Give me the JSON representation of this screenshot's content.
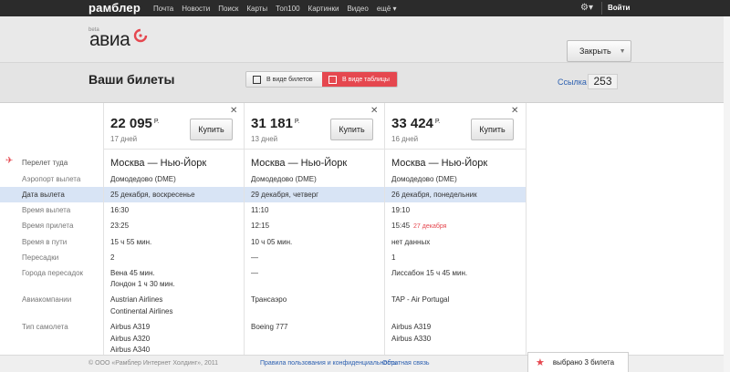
{
  "topbar": {
    "logo": "рамблер",
    "nav": [
      "Почта",
      "Новости",
      "Поиск",
      "Карты",
      "Топ100",
      "Картинки",
      "Видео",
      "ещё ▾"
    ],
    "gear_icon": "gear-icon",
    "login": "Войти"
  },
  "brand": {
    "beta": "beta",
    "name": "авиа"
  },
  "header": {
    "close_label": "Закрыть"
  },
  "subbar": {
    "title": "Ваши билеты",
    "view_cards": "В виде билетов",
    "view_table": "В виде таблицы",
    "link": "Ссылка",
    "count": "253"
  },
  "row_labels": [
    "Перелет туда",
    "Аэропорт вылета",
    "Дата вылета",
    "Время вылета",
    "Время прилета",
    "Время в пути",
    "Пересадки",
    "Города пересадок",
    "Авиакомпании",
    "Тип самолета"
  ],
  "tickets": [
    {
      "price": "22 095",
      "currency": "Р.",
      "days": "17 дней",
      "buy": "Купить",
      "route": "Москва — Нью-Йорк",
      "airport": "Домодедово (DME)",
      "date": "25 декабря, воскресенье",
      "dep": "16:30",
      "arr": "23:25",
      "arr_note": "",
      "duration": "15 ч 55 мин.",
      "stops": "2",
      "stop_cities": [
        "Вена 45 мин.",
        "Лондон 1 ч 30 мин."
      ],
      "airlines": [
        "Austrian Airlines",
        "Continental Airlines"
      ],
      "aircraft": [
        "Airbus A319",
        "Airbus A320",
        "Airbus A340"
      ]
    },
    {
      "price": "31 181",
      "currency": "Р.",
      "days": "13 дней",
      "buy": "Купить",
      "route": "Москва — Нью-Йорк",
      "airport": "Домодедово (DME)",
      "date": "29 декабря, четверг",
      "dep": "11:10",
      "arr": "12:15",
      "arr_note": "",
      "duration": "10 ч 05 мин.",
      "stops": "—",
      "stop_cities": [
        "—"
      ],
      "airlines": [
        "Трансаэро"
      ],
      "aircraft": [
        "Boeing 777"
      ]
    },
    {
      "price": "33 424",
      "currency": "Р.",
      "days": "16 дней",
      "buy": "Купить",
      "route": "Москва — Нью-Йорк",
      "airport": "Домодедово (DME)",
      "date": "26 декабря, понедельник",
      "dep": "19:10",
      "arr": "15:45",
      "arr_note": "27 декабря",
      "duration": "нет данных",
      "stops": "1",
      "stop_cities": [
        "Лиссабон 15 ч 45 мин."
      ],
      "airlines": [
        "TAP - Air Portugal"
      ],
      "aircraft": [
        "Airbus A319",
        "Airbus A330"
      ]
    }
  ],
  "footer": {
    "copyright": "© ООО «Рамблер Интернет Холдинг», 2011",
    "privacy": "Правила пользования и конфиденциальность",
    "feedback": "Обратная связь",
    "chosen": "выбрано 3 билета"
  },
  "colors": {
    "accent": "#e5474f",
    "highlight": "#d8e4f5",
    "link": "#2b5fb0"
  }
}
